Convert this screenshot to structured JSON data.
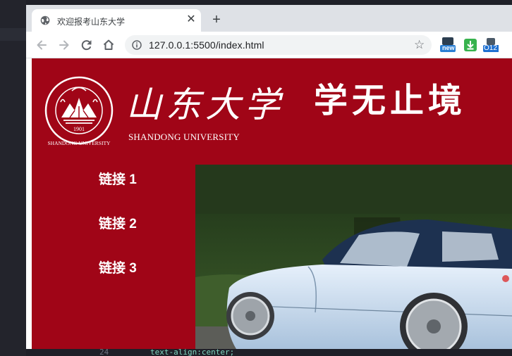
{
  "browser": {
    "tab": {
      "title": "欢迎报考山东大学"
    },
    "address": {
      "url": "127.0.0.1:5500/index.html"
    },
    "extensions": [
      {
        "icon": "new-badge-extension-icon",
        "label": "new"
      },
      {
        "icon": "download-extension-icon",
        "label": ""
      },
      {
        "icon": "o12-extension-icon",
        "label": "O12"
      }
    ]
  },
  "header": {
    "school_name_cn": "山东大学",
    "school_name_en": "SHANDONG UNIVERSITY",
    "motto": "学无止境",
    "seal": {
      "year": "1901",
      "ring_text": "SHANDONG UNIVERSITY"
    }
  },
  "nav": {
    "links": [
      {
        "label": "链接 1"
      },
      {
        "label": "链接 2"
      },
      {
        "label": "链接 3"
      }
    ]
  },
  "editor": {
    "bottom_line_num": "24",
    "bottom_code": "text-align:center;"
  },
  "colors": {
    "brand_red": "#a00517",
    "tab_strip": "#dee1e6",
    "omnibox": "#f1f3f4"
  }
}
